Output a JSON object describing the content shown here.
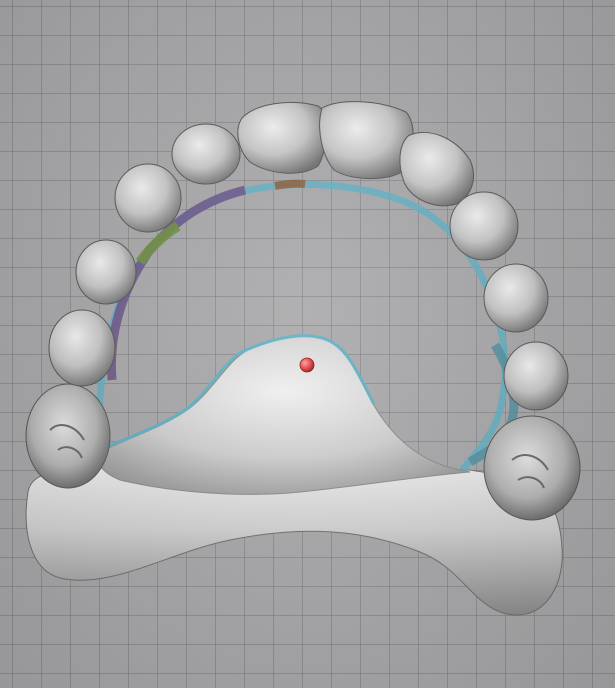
{
  "viewport": {
    "background_color": "#a8a8aa",
    "grid_line_color": "#78787c"
  },
  "model": {
    "object_name": "maxillary-arch-scan",
    "tooth_color": "#cfcfcf",
    "palate_color": "#d6d6d6",
    "margin_line_color": "#5fb0c4",
    "segment_colors": [
      "#6a4f86",
      "#4f7a5a",
      "#6e8f3f",
      "#8a5e3a",
      "#5aa0b0"
    ],
    "marker_color": "#e53a3a"
  }
}
